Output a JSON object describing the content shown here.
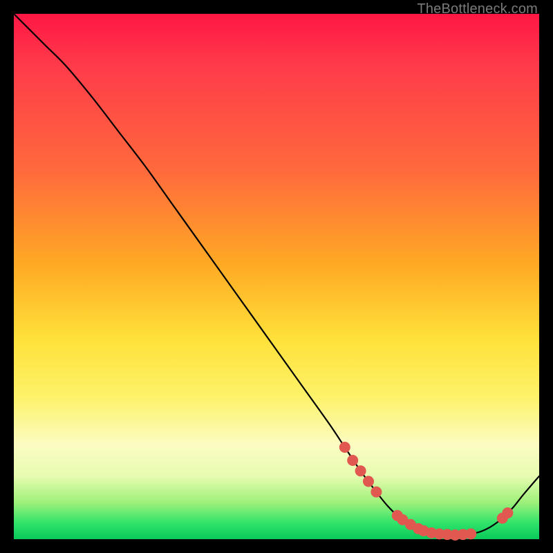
{
  "watermark": {
    "text": "TheBottleneck.com"
  },
  "colors": {
    "curve_stroke": "#000000",
    "dot_fill": "#e0584f",
    "dot_stroke": "#e0584f"
  },
  "chart_data": {
    "type": "line",
    "title": "",
    "xlabel": "",
    "ylabel": "",
    "xlim": [
      0,
      100
    ],
    "ylim": [
      0,
      100
    ],
    "grid": false,
    "legend": false,
    "series": [
      {
        "name": "bottleneck-curve",
        "x": [
          0,
          3,
          6,
          10,
          15,
          20,
          25,
          30,
          35,
          40,
          45,
          50,
          55,
          60,
          63,
          66,
          69,
          71,
          73,
          75,
          77,
          79,
          81,
          83,
          85,
          87,
          89,
          91,
          93,
          95,
          97,
          100
        ],
        "y": [
          100,
          97,
          94,
          90,
          84,
          77.5,
          71,
          64,
          57,
          50,
          43,
          36,
          29,
          22,
          17.5,
          13,
          9,
          6.5,
          4.5,
          3,
          2,
          1.4,
          1,
          0.8,
          0.8,
          1,
          1.5,
          2.5,
          4,
          6,
          8.5,
          12
        ]
      }
    ],
    "highlight_dots": {
      "name": "sample-points",
      "points": [
        {
          "x": 63.0,
          "y": 17.5
        },
        {
          "x": 64.5,
          "y": 15.0
        },
        {
          "x": 66.0,
          "y": 13.0
        },
        {
          "x": 67.5,
          "y": 11.0
        },
        {
          "x": 69.0,
          "y": 9.0
        },
        {
          "x": 73.0,
          "y": 4.5
        },
        {
          "x": 74.0,
          "y": 3.7
        },
        {
          "x": 75.5,
          "y": 2.8
        },
        {
          "x": 77.0,
          "y": 2.0
        },
        {
          "x": 78.0,
          "y": 1.6
        },
        {
          "x": 79.5,
          "y": 1.2
        },
        {
          "x": 81.0,
          "y": 1.0
        },
        {
          "x": 82.5,
          "y": 0.9
        },
        {
          "x": 84.0,
          "y": 0.8
        },
        {
          "x": 85.5,
          "y": 0.9
        },
        {
          "x": 87.0,
          "y": 1.0
        },
        {
          "x": 93.0,
          "y": 4.0
        },
        {
          "x": 94.0,
          "y": 5.0
        }
      ]
    }
  }
}
